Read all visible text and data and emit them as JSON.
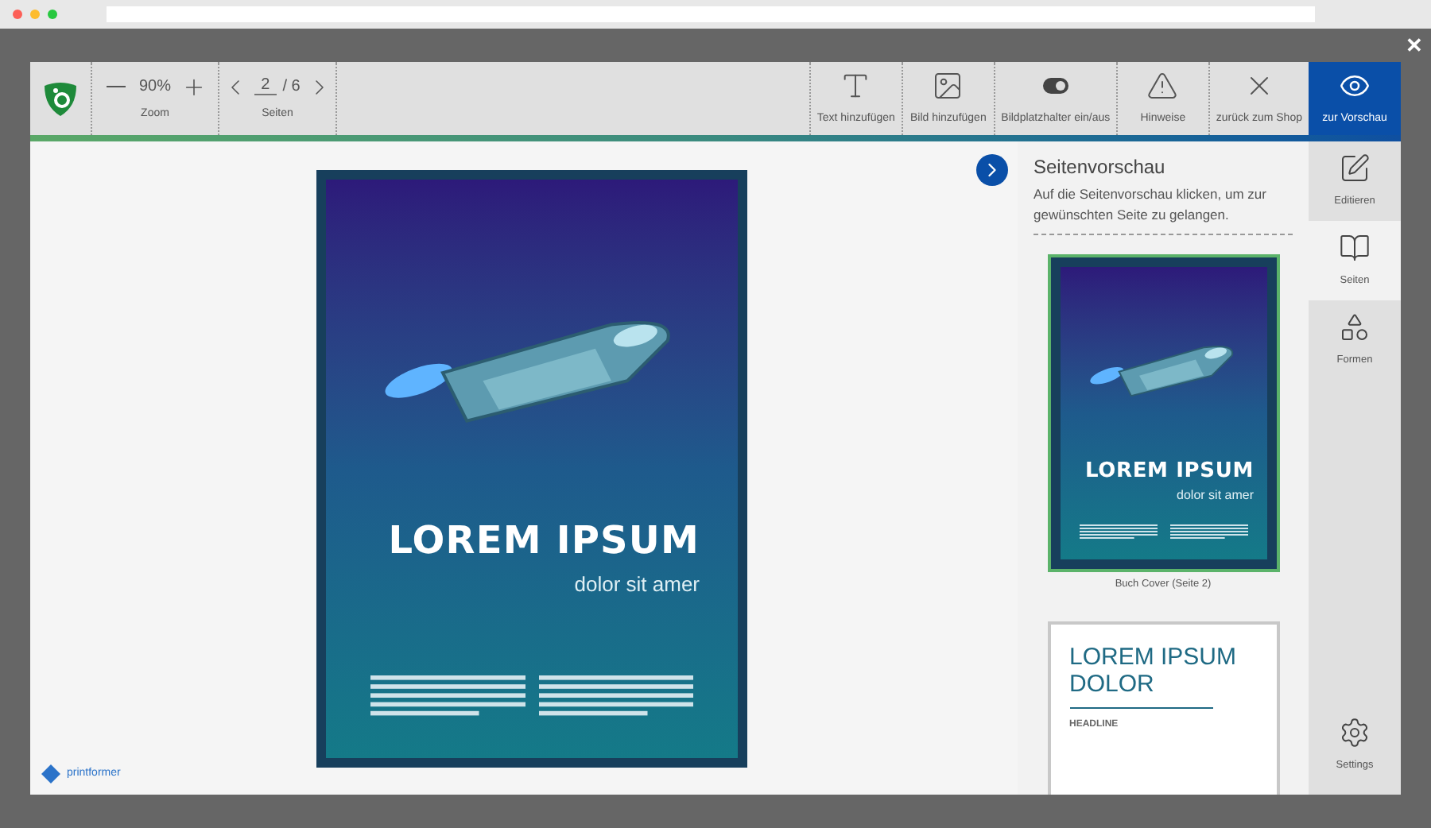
{
  "close_button": "✕",
  "toolbar": {
    "zoom": {
      "value": "90%",
      "label": "Zoom"
    },
    "pages": {
      "current": "2",
      "total": "/ 6",
      "label": "Seiten"
    },
    "actions": [
      {
        "kind": "text",
        "label": "Text hinzufügen",
        "selected": false
      },
      {
        "kind": "image",
        "label": "Bild hinzufügen",
        "selected": false
      },
      {
        "kind": "toggle",
        "label": "Bildplatzhalter ein/aus",
        "selected": false,
        "on": true
      },
      {
        "kind": "warning",
        "label": "Hinweise",
        "selected": false
      },
      {
        "kind": "close",
        "label": "zurück zum Shop",
        "selected": false
      },
      {
        "kind": "preview",
        "label": "zur Vorschau",
        "selected": true
      }
    ]
  },
  "canvas": {
    "poster": {
      "title": "LOREM IPSUM",
      "subtitle": "dolor sit amer"
    },
    "brand": "printformer"
  },
  "preview_panel": {
    "title": "Seitenvorschau",
    "description": "Auf die Seitenvorschau klicken, um zur gewünschten Seite zu gelangen.",
    "pages": [
      {
        "kind": "cover",
        "title": "LOREM IPSUM",
        "subtitle": "dolor sit amer",
        "caption": "Buch Cover (Seite 2)",
        "selected": true
      },
      {
        "kind": "article",
        "title": "LOREM IPSUM DOLOR",
        "headline": "HEADLINE",
        "selected": false
      }
    ]
  },
  "side_tabs": [
    {
      "kind": "edit",
      "label": "Editieren",
      "selected": false
    },
    {
      "kind": "pages",
      "label": "Seiten",
      "selected": true
    },
    {
      "kind": "shapes",
      "label": "Formen",
      "selected": false
    },
    {
      "kind": "settings",
      "label": "Settings",
      "selected": false
    }
  ]
}
